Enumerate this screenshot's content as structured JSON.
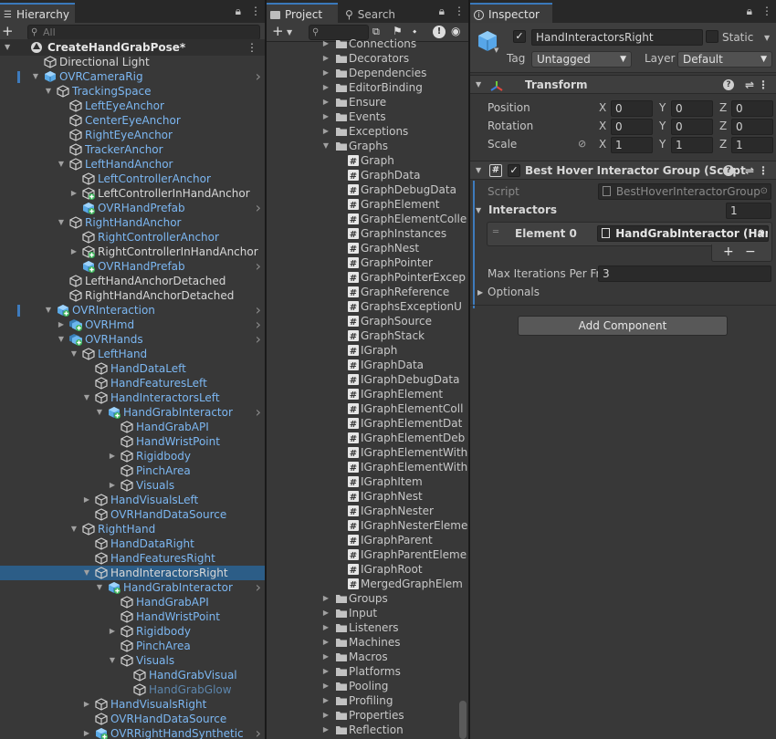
{
  "hierarchy": {
    "tab_label": "Hierarchy",
    "search_placeholder": "All",
    "scene_name": "CreateHandGrabPose*",
    "rows": [
      {
        "label": "Directional Light",
        "depth": 2,
        "color": "white",
        "icon": "cube",
        "arrow": "none",
        "chev": false
      },
      {
        "label": "OVRCameraRig",
        "depth": 2,
        "color": "blue",
        "icon": "prefab",
        "arrow": "open",
        "chev": true,
        "bar": true
      },
      {
        "label": "TrackingSpace",
        "depth": 3,
        "color": "blue",
        "icon": "cube",
        "arrow": "open",
        "chev": false
      },
      {
        "label": "LeftEyeAnchor",
        "depth": 4,
        "color": "blue",
        "icon": "cube",
        "arrow": "none",
        "chev": false
      },
      {
        "label": "CenterEyeAnchor",
        "depth": 4,
        "color": "blue",
        "icon": "cube",
        "arrow": "none",
        "chev": false
      },
      {
        "label": "RightEyeAnchor",
        "depth": 4,
        "color": "blue",
        "icon": "cube",
        "arrow": "none",
        "chev": false
      },
      {
        "label": "TrackerAnchor",
        "depth": 4,
        "color": "blue",
        "icon": "cube",
        "arrow": "none",
        "chev": false
      },
      {
        "label": "LeftHandAnchor",
        "depth": 4,
        "color": "blue",
        "icon": "cube",
        "arrow": "open",
        "chev": false
      },
      {
        "label": "LeftControllerAnchor",
        "depth": 5,
        "color": "blue",
        "icon": "cube",
        "arrow": "none",
        "chev": false
      },
      {
        "label": "LeftControllerInHandAnchor",
        "depth": 5,
        "color": "white",
        "icon": "cube-plus",
        "arrow": "closed",
        "chev": false
      },
      {
        "label": "OVRHandPrefab",
        "depth": 5,
        "color": "blue",
        "icon": "prefab-plus",
        "arrow": "none",
        "chev": true
      },
      {
        "label": "RightHandAnchor",
        "depth": 4,
        "color": "blue",
        "icon": "cube",
        "arrow": "open",
        "chev": false
      },
      {
        "label": "RightControllerAnchor",
        "depth": 5,
        "color": "blue",
        "icon": "cube",
        "arrow": "none",
        "chev": false
      },
      {
        "label": "RightControllerInHandAnchor",
        "depth": 5,
        "color": "white",
        "icon": "cube-plus",
        "arrow": "closed",
        "chev": false
      },
      {
        "label": "OVRHandPrefab",
        "depth": 5,
        "color": "blue",
        "icon": "prefab-plus",
        "arrow": "none",
        "chev": true
      },
      {
        "label": "LeftHandAnchorDetached",
        "depth": 4,
        "color": "white",
        "icon": "cube",
        "arrow": "none",
        "chev": false
      },
      {
        "label": "RightHandAnchorDetached",
        "depth": 4,
        "color": "white",
        "icon": "cube",
        "arrow": "none",
        "chev": false
      },
      {
        "label": "OVRInteraction",
        "depth": 3,
        "color": "blue",
        "icon": "prefab-plus",
        "arrow": "open",
        "chev": true,
        "bar": true
      },
      {
        "label": "OVRHmd",
        "depth": 4,
        "color": "blue",
        "icon": "prefab-multi",
        "arrow": "closed",
        "chev": true
      },
      {
        "label": "OVRHands",
        "depth": 4,
        "color": "blue",
        "icon": "prefab-multi",
        "arrow": "open",
        "chev": true
      },
      {
        "label": "LeftHand",
        "depth": 5,
        "color": "blue",
        "icon": "cube",
        "arrow": "open",
        "chev": false
      },
      {
        "label": "HandDataLeft",
        "depth": 6,
        "color": "blue",
        "icon": "cube",
        "arrow": "none",
        "chev": false
      },
      {
        "label": "HandFeaturesLeft",
        "depth": 6,
        "color": "blue",
        "icon": "cube",
        "arrow": "none",
        "chev": false
      },
      {
        "label": "HandInteractorsLeft",
        "depth": 6,
        "color": "blue",
        "icon": "cube",
        "arrow": "open",
        "chev": false
      },
      {
        "label": "HandGrabInteractor",
        "depth": 7,
        "color": "blue",
        "icon": "prefab-plus",
        "arrow": "open",
        "chev": true
      },
      {
        "label": "HandGrabAPI",
        "depth": 8,
        "color": "blue",
        "icon": "cube",
        "arrow": "none",
        "chev": false
      },
      {
        "label": "HandWristPoint",
        "depth": 8,
        "color": "blue",
        "icon": "cube",
        "arrow": "none",
        "chev": false
      },
      {
        "label": "Rigidbody",
        "depth": 8,
        "color": "blue",
        "icon": "cube",
        "arrow": "closed",
        "chev": false
      },
      {
        "label": "PinchArea",
        "depth": 8,
        "color": "blue",
        "icon": "cube",
        "arrow": "none",
        "chev": false
      },
      {
        "label": "Visuals",
        "depth": 8,
        "color": "blue",
        "icon": "cube",
        "arrow": "closed",
        "chev": false
      },
      {
        "label": "HandVisualsLeft",
        "depth": 6,
        "color": "blue",
        "icon": "cube",
        "arrow": "closed",
        "chev": false
      },
      {
        "label": "OVRHandDataSource",
        "depth": 6,
        "color": "blue",
        "icon": "cube",
        "arrow": "none",
        "chev": false
      },
      {
        "label": "RightHand",
        "depth": 5,
        "color": "blue",
        "icon": "cube",
        "arrow": "open",
        "chev": false
      },
      {
        "label": "HandDataRight",
        "depth": 6,
        "color": "blue",
        "icon": "cube",
        "arrow": "none",
        "chev": false
      },
      {
        "label": "HandFeaturesRight",
        "depth": 6,
        "color": "blue",
        "icon": "cube",
        "arrow": "none",
        "chev": false
      },
      {
        "label": "HandInteractorsRight",
        "depth": 6,
        "color": "white",
        "icon": "cube",
        "arrow": "open",
        "chev": false,
        "selected": true
      },
      {
        "label": "HandGrabInteractor",
        "depth": 7,
        "color": "blue",
        "icon": "prefab-plus",
        "arrow": "open",
        "chev": true
      },
      {
        "label": "HandGrabAPI",
        "depth": 8,
        "color": "blue",
        "icon": "cube",
        "arrow": "none",
        "chev": false
      },
      {
        "label": "HandWristPoint",
        "depth": 8,
        "color": "blue",
        "icon": "cube",
        "arrow": "none",
        "chev": false
      },
      {
        "label": "Rigidbody",
        "depth": 8,
        "color": "blue",
        "icon": "cube",
        "arrow": "closed",
        "chev": false
      },
      {
        "label": "PinchArea",
        "depth": 8,
        "color": "blue",
        "icon": "cube",
        "arrow": "none",
        "chev": false
      },
      {
        "label": "Visuals",
        "depth": 8,
        "color": "blue",
        "icon": "cube",
        "arrow": "open",
        "chev": false
      },
      {
        "label": "HandGrabVisual",
        "depth": 9,
        "color": "blue",
        "icon": "cube",
        "arrow": "none",
        "chev": false
      },
      {
        "label": "HandGrabGlow",
        "depth": 9,
        "color": "dim",
        "icon": "cube",
        "arrow": "none",
        "chev": false
      },
      {
        "label": "HandVisualsRight",
        "depth": 6,
        "color": "blue",
        "icon": "cube",
        "arrow": "closed",
        "chev": false
      },
      {
        "label": "OVRHandDataSource",
        "depth": 6,
        "color": "blue",
        "icon": "cube",
        "arrow": "none",
        "chev": false
      },
      {
        "label": "OVRRightHandSynthetic",
        "depth": 6,
        "color": "blue",
        "icon": "prefab-plus",
        "arrow": "closed",
        "chev": true
      }
    ]
  },
  "project": {
    "tab_label": "Project",
    "search_tab_label": "Search",
    "badge_count": "28",
    "rows": [
      {
        "label": "Connections",
        "type": "folder",
        "arrow": "closed"
      },
      {
        "label": "Decorators",
        "type": "folder",
        "arrow": "closed"
      },
      {
        "label": "Dependencies",
        "type": "folder",
        "arrow": "closed"
      },
      {
        "label": "EditorBinding",
        "type": "folder",
        "arrow": "closed"
      },
      {
        "label": "Ensure",
        "type": "folder",
        "arrow": "closed"
      },
      {
        "label": "Events",
        "type": "folder",
        "arrow": "closed"
      },
      {
        "label": "Exceptions",
        "type": "folder",
        "arrow": "closed"
      },
      {
        "label": "Graphs",
        "type": "folder",
        "arrow": "open"
      },
      {
        "label": "Graph",
        "type": "script"
      },
      {
        "label": "GraphData",
        "type": "script"
      },
      {
        "label": "GraphDebugData",
        "type": "script"
      },
      {
        "label": "GraphElement",
        "type": "script"
      },
      {
        "label": "GraphElementColle",
        "type": "script"
      },
      {
        "label": "GraphInstances",
        "type": "script"
      },
      {
        "label": "GraphNest",
        "type": "script"
      },
      {
        "label": "GraphPointer",
        "type": "script"
      },
      {
        "label": "GraphPointerExcep",
        "type": "script"
      },
      {
        "label": "GraphReference",
        "type": "script"
      },
      {
        "label": "GraphsExceptionU",
        "type": "script"
      },
      {
        "label": "GraphSource",
        "type": "script"
      },
      {
        "label": "GraphStack",
        "type": "script"
      },
      {
        "label": "IGraph",
        "type": "script"
      },
      {
        "label": "IGraphData",
        "type": "script"
      },
      {
        "label": "IGraphDebugData",
        "type": "script"
      },
      {
        "label": "IGraphElement",
        "type": "script"
      },
      {
        "label": "IGraphElementColl",
        "type": "script"
      },
      {
        "label": "IGraphElementDat",
        "type": "script"
      },
      {
        "label": "IGraphElementDeb",
        "type": "script"
      },
      {
        "label": "IGraphElementWith",
        "type": "script"
      },
      {
        "label": "IGraphElementWith",
        "type": "script"
      },
      {
        "label": "IGraphItem",
        "type": "script"
      },
      {
        "label": "IGraphNest",
        "type": "script"
      },
      {
        "label": "IGraphNester",
        "type": "script"
      },
      {
        "label": "IGraphNesterEleme",
        "type": "script"
      },
      {
        "label": "IGraphParent",
        "type": "script"
      },
      {
        "label": "IGraphParentEleme",
        "type": "script"
      },
      {
        "label": "IGraphRoot",
        "type": "script"
      },
      {
        "label": "MergedGraphElem",
        "type": "script"
      },
      {
        "label": "Groups",
        "type": "folder",
        "arrow": "closed"
      },
      {
        "label": "Input",
        "type": "folder",
        "arrow": "closed"
      },
      {
        "label": "Listeners",
        "type": "folder",
        "arrow": "closed"
      },
      {
        "label": "Machines",
        "type": "folder",
        "arrow": "closed"
      },
      {
        "label": "Macros",
        "type": "folder",
        "arrow": "closed"
      },
      {
        "label": "Platforms",
        "type": "folder",
        "arrow": "closed"
      },
      {
        "label": "Pooling",
        "type": "folder",
        "arrow": "closed"
      },
      {
        "label": "Profiling",
        "type": "folder",
        "arrow": "closed"
      },
      {
        "label": "Properties",
        "type": "folder",
        "arrow": "closed"
      },
      {
        "label": "Reflection",
        "type": "folder",
        "arrow": "closed"
      }
    ]
  },
  "inspector": {
    "tab_label": "Inspector",
    "object_name": "HandInteractorsRight",
    "static_label": "Static",
    "tag_label": "Tag",
    "tag_value": "Untagged",
    "layer_label": "Layer",
    "layer_value": "Default",
    "transform": {
      "title": "Transform",
      "position_label": "Position",
      "rotation_label": "Rotation",
      "scale_label": "Scale",
      "position": {
        "x": "0",
        "y": "0",
        "z": "0"
      },
      "rotation": {
        "x": "0",
        "y": "0",
        "z": "0"
      },
      "scale": {
        "x": "1",
        "y": "1",
        "z": "1"
      },
      "x_label": "X",
      "y_label": "Y",
      "z_label": "Z"
    },
    "component": {
      "title": "Best Hover Interactor Group (Script",
      "script_label": "Script",
      "script_value": "BestHoverInteractorGroup",
      "interactors_label": "Interactors",
      "interactors_count": "1",
      "element_label": "Element 0",
      "element_value": "HandGrabInteractor (Han",
      "plus_label": "+",
      "minus_label": "−",
      "max_iter_label": "Max Iterations Per Fra",
      "max_iter_value": "3",
      "optionals_label": "Optionals"
    },
    "add_component_label": "Add Component"
  },
  "colors": {
    "selection": "#2c5d87",
    "prefab_blue": "#7cb7f2",
    "tab_accent": "#3a79bb"
  }
}
